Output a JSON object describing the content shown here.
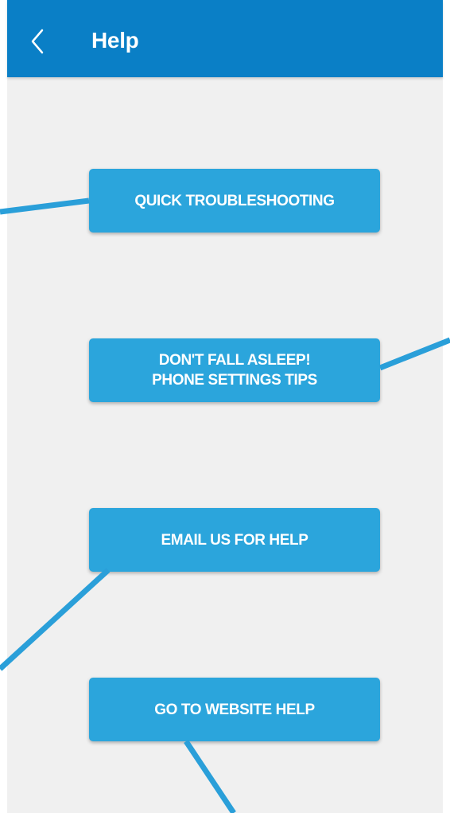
{
  "header": {
    "title": "Help",
    "back_icon": "chevron-left-icon"
  },
  "buttons": {
    "quick_troubleshooting": "QUICK TROUBLESHOOTING",
    "phone_settings_line1": "DON'T FALL ASLEEP!",
    "phone_settings_line2": "PHONE SETTINGS TIPS",
    "email_help": "EMAIL US FOR HELP",
    "website_help": "GO TO WEBSITE HELP"
  },
  "colors": {
    "appbar": "#0a7fc6",
    "button": "#2ba5dc",
    "background": "#f0f0f0",
    "callout_line": "#2a9fd9"
  }
}
